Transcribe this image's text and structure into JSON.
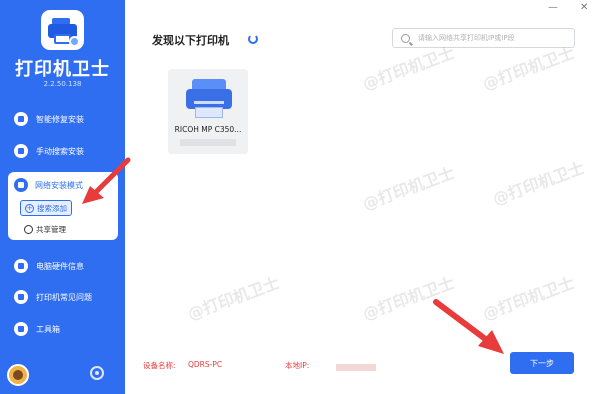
{
  "app": {
    "title": "打印机卫士",
    "version": "2.2.50.138"
  },
  "sidebar": {
    "items": [
      {
        "label": "智能修复安装",
        "icon": "repair-icon"
      },
      {
        "label": "手动搜索安装",
        "icon": "wrench-icon"
      },
      {
        "label": "网络安装模式",
        "icon": "network-shield-icon"
      },
      {
        "label": "电脑硬件信息",
        "icon": "hardware-icon"
      },
      {
        "label": "打印机常见问题",
        "icon": "faq-icon"
      },
      {
        "label": "工具箱",
        "icon": "toolbox-icon"
      }
    ],
    "submenu": [
      {
        "label": "搜索添加",
        "icon": "search-add-icon",
        "active": true
      },
      {
        "label": "共享管理",
        "icon": "cloud-icon",
        "active": false
      }
    ]
  },
  "main": {
    "title": "发现以下打印机",
    "search_placeholder": "请输入网络共享打印机IP或IP段",
    "printers": [
      {
        "name": "RICOH MP C350..."
      }
    ]
  },
  "footer": {
    "device_label": "设备名称:",
    "device_value": "QDRS-PC",
    "ip_label": "本地IP:",
    "next_label": "下一步"
  },
  "window": {
    "minimize": "—",
    "close": "✕"
  },
  "watermark": "@打印机卫士",
  "colors": {
    "accent": "#2f6ef1",
    "annotation": "#e83b3b"
  }
}
